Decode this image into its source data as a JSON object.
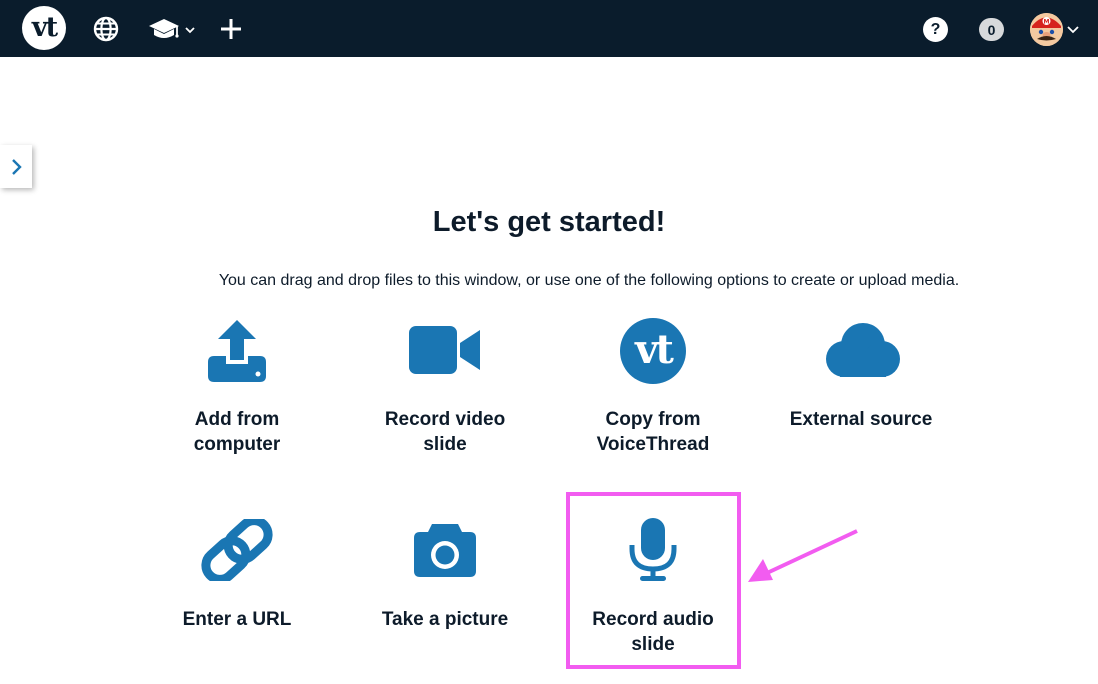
{
  "topbar": {
    "logo_text": "vt",
    "notification_count": "0",
    "help_label": "?"
  },
  "main": {
    "title": "Let's get started!",
    "subtitle": "You can drag and drop files to this window, or use one of the following options to create or upload media."
  },
  "options": [
    {
      "line1": "Add from",
      "line2": "computer",
      "icon": "upload-icon"
    },
    {
      "line1": "Record video",
      "line2": "slide",
      "icon": "video-camera-icon"
    },
    {
      "line1": "Copy from",
      "line2": "VoiceThread",
      "icon": "voicethread-logo-icon",
      "icon_text": "vt"
    },
    {
      "line1": "External source",
      "line2": "",
      "icon": "cloud-icon"
    },
    {
      "line1": "Enter a URL",
      "line2": "",
      "icon": "link-icon"
    },
    {
      "line1": "Take a picture",
      "line2": "",
      "icon": "camera-icon"
    },
    {
      "line1": "Record audio",
      "line2": "slide",
      "icon": "microphone-icon"
    }
  ],
  "colors": {
    "topbar": "#0a1c2c",
    "accent_blue": "#1a76b3",
    "highlight": "#f25cf0",
    "text": "#0d1b2a"
  }
}
